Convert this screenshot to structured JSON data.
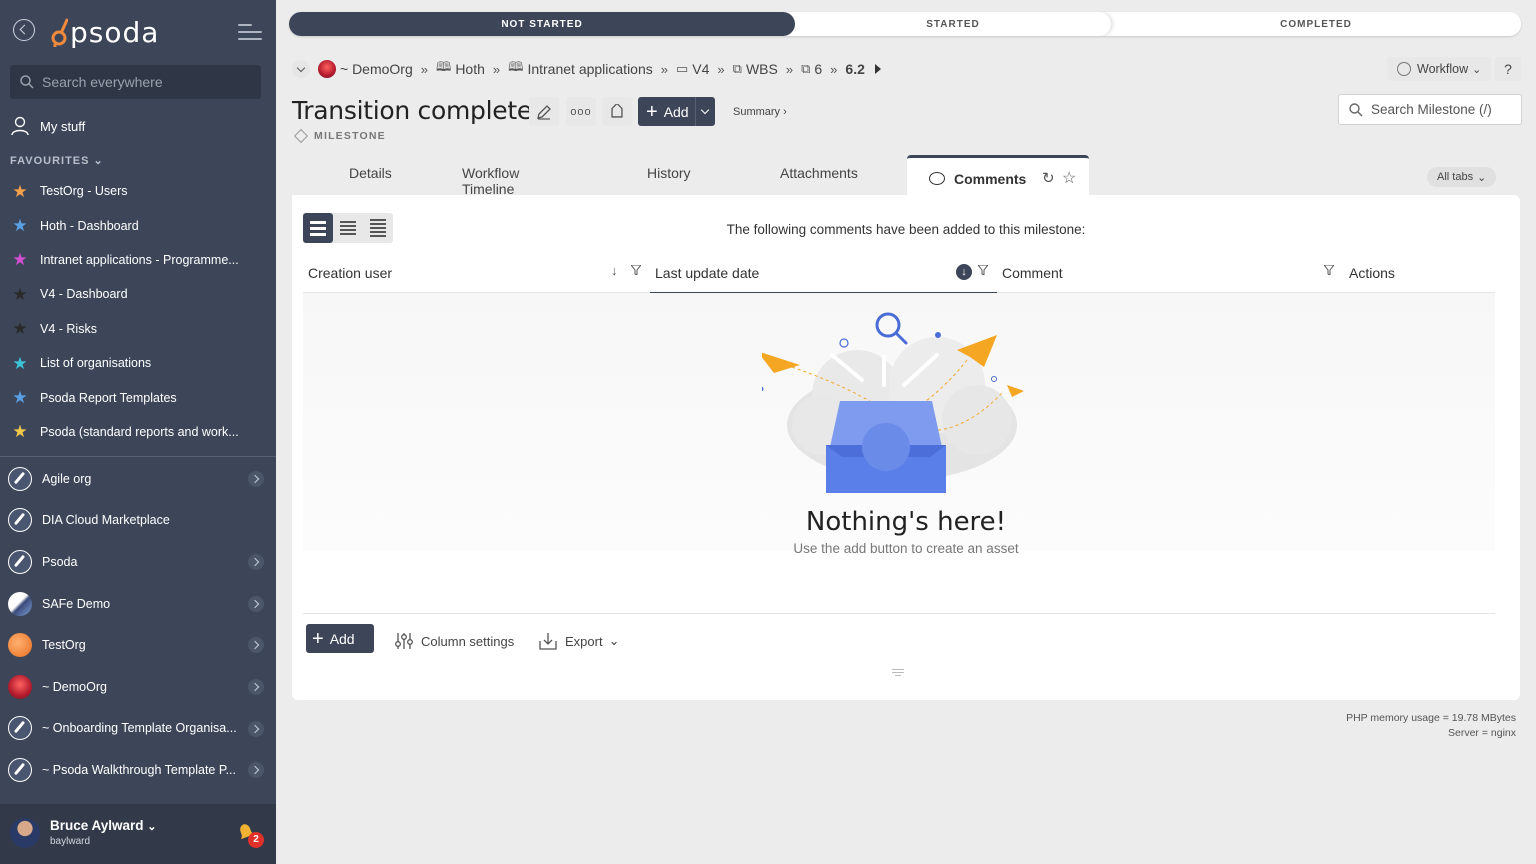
{
  "sidebar": {
    "logo_text": "psoda",
    "search_placeholder": "Search everywhere",
    "my_stuff": "My stuff",
    "favourites_header": "FAVOURITES",
    "favourites": [
      {
        "label": "TestOrg - Users",
        "star_color": "#f5a04a"
      },
      {
        "label": "Hoth - Dashboard",
        "star_color": "#5aa0e6"
      },
      {
        "label": "Intranet applications - Programme...",
        "star_color": "#d24fd2"
      },
      {
        "label": "V4 - Dashboard",
        "star_color": "#2a2a2a"
      },
      {
        "label": "V4 - Risks",
        "star_color": "#2a2a2a"
      },
      {
        "label": "List of organisations",
        "star_color": "#3cc4d8"
      },
      {
        "label": "Psoda Report Templates",
        "star_color": "#5aa0e6"
      },
      {
        "label": "Psoda (standard reports and work...",
        "star_color": "#f2c84b"
      }
    ],
    "orgs": [
      {
        "label": "Agile org",
        "icon": "rocket",
        "chevron": true
      },
      {
        "label": "DIA Cloud Marketplace",
        "icon": "rocket",
        "chevron": false
      },
      {
        "label": "Psoda",
        "icon": "rocket",
        "chevron": true
      },
      {
        "label": "SAFe Demo",
        "icon": "safe",
        "chevron": true
      },
      {
        "label": "TestOrg",
        "icon": "testorg",
        "chevron": true
      },
      {
        "label": "~ DemoOrg",
        "icon": "demo",
        "chevron": true
      },
      {
        "label": "~ Onboarding Template Organisa...",
        "icon": "rocket",
        "chevron": true
      },
      {
        "label": "~ Psoda Walkthrough Template P...",
        "icon": "rocket",
        "chevron": true
      }
    ],
    "user": {
      "name": "Bruce Aylward",
      "username": "baylward",
      "notifications": "2"
    }
  },
  "progress": {
    "not_started": "NOT STARTED",
    "started": "STARTED",
    "completed": "COMPLETED"
  },
  "breadcrumb": [
    {
      "label": "~ DemoOrg"
    },
    {
      "label": "Hoth"
    },
    {
      "label": "Intranet applications"
    },
    {
      "label": "V4"
    },
    {
      "label": "WBS"
    },
    {
      "label": "6"
    },
    {
      "label": "6.2"
    }
  ],
  "header": {
    "workflow": "Workflow",
    "help": "?",
    "title": "Transition complete",
    "add": "Add",
    "summary": "Summary ›",
    "type": "MILESTONE",
    "search_milestone": "Search Milestone (/)"
  },
  "tabs": {
    "details": "Details",
    "timeline": "Workflow Timeline",
    "history": "History",
    "attachments": "Attachments",
    "comments": "Comments",
    "all_tabs": "All tabs"
  },
  "panel": {
    "intro": "The following comments have been added to this milestone:",
    "columns": {
      "creation_user": "Creation user",
      "last_update": "Last update date",
      "comment": "Comment",
      "actions": "Actions"
    },
    "empty_title": "Nothing's here!",
    "empty_sub": "Use the add button to create an asset",
    "add": "Add",
    "column_settings": "Column settings",
    "export": "Export"
  },
  "footer": {
    "memory": "PHP memory usage = 19.78 MBytes",
    "server": "Server = nginx"
  }
}
